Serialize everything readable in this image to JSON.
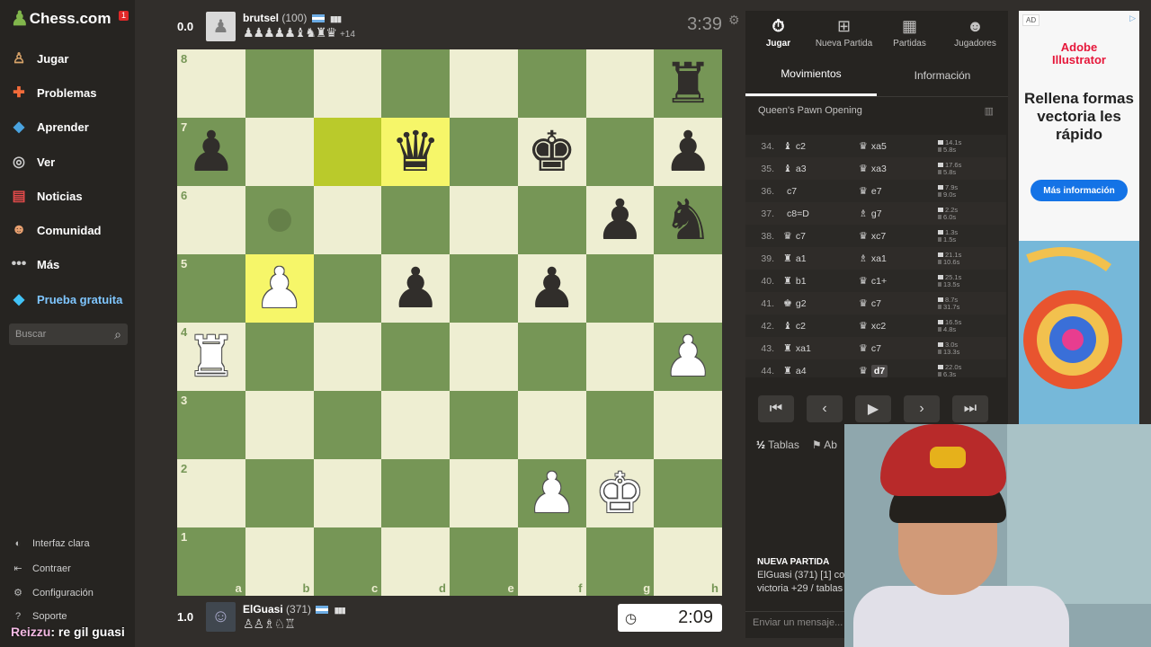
{
  "sidebar": {
    "logo_text": "Chess.com",
    "badge": "1",
    "items": [
      {
        "label": "Jugar",
        "icon": "play-icon"
      },
      {
        "label": "Problemas",
        "icon": "puzzle-icon"
      },
      {
        "label": "Aprender",
        "icon": "learn-icon"
      },
      {
        "label": "Ver",
        "icon": "watch-icon"
      },
      {
        "label": "Noticias",
        "icon": "news-icon"
      },
      {
        "label": "Comunidad",
        "icon": "community-icon"
      },
      {
        "label": "Más",
        "icon": "more-icon"
      },
      {
        "label": "Prueba gratuita",
        "icon": "diamond-icon"
      }
    ],
    "search_placeholder": "Buscar",
    "bottom": [
      {
        "label": "Interfaz clara",
        "icon": "theme-icon"
      },
      {
        "label": "Contraer",
        "icon": "collapse-icon"
      },
      {
        "label": "Configuración",
        "icon": "settings-icon"
      },
      {
        "label": "Soporte",
        "icon": "support-icon"
      }
    ]
  },
  "chat_overlay": {
    "user": "Reizzu",
    "message": ": re gil guasi"
  },
  "top_player": {
    "score": "0.0",
    "name": "brutsel",
    "rating": "(100)",
    "captured": "♟♟♟♟♟♝♞♜♛",
    "advantage": "+14",
    "clock": "3:39"
  },
  "bottom_player": {
    "score": "1.0",
    "name": "ElGuasi",
    "rating": "(371)",
    "captured": "♙♙♗♘♖",
    "clock": "2:09"
  },
  "board": {
    "files": [
      "a",
      "b",
      "c",
      "d",
      "e",
      "f",
      "g",
      "h"
    ],
    "ranks": [
      "8",
      "7",
      "6",
      "5",
      "4",
      "3",
      "2",
      "1"
    ],
    "highlights": [
      "c7",
      "d7",
      "b5"
    ],
    "move_hint": "b6",
    "pieces": {
      "h8": {
        "glyph": "♜",
        "color": "black"
      },
      "a7": {
        "glyph": "♟",
        "color": "black"
      },
      "d7": {
        "glyph": "♛",
        "color": "black"
      },
      "f7": {
        "glyph": "♚",
        "color": "black"
      },
      "h7": {
        "glyph": "♟",
        "color": "black"
      },
      "g6": {
        "glyph": "♟",
        "color": "black"
      },
      "h6": {
        "glyph": "♞",
        "color": "black"
      },
      "b5": {
        "glyph": "♟",
        "color": "white"
      },
      "d5": {
        "glyph": "♟",
        "color": "black"
      },
      "f5": {
        "glyph": "♟",
        "color": "black"
      },
      "a4": {
        "glyph": "♜",
        "color": "white"
      },
      "h4": {
        "glyph": "♟",
        "color": "white"
      },
      "f2": {
        "glyph": "♟",
        "color": "white"
      },
      "g2": {
        "glyph": "♚",
        "color": "white"
      }
    }
  },
  "panel": {
    "tabs": [
      {
        "label": "Jugar",
        "icon": "timer-icon"
      },
      {
        "label": "Nueva Partida",
        "icon": "plus-icon"
      },
      {
        "label": "Partidas",
        "icon": "games-icon"
      },
      {
        "label": "Jugadores",
        "icon": "players-icon"
      }
    ],
    "subtabs": [
      "Movimientos",
      "Información"
    ],
    "opening": "Queen's Pawn Opening",
    "moves": [
      {
        "n": "34.",
        "wi": "♝",
        "w": "c2",
        "bi": "♛",
        "b": "xa5",
        "tw": "14.1s",
        "tb": "5.8s"
      },
      {
        "n": "35.",
        "wi": "♝",
        "w": "a3",
        "bi": "♛",
        "b": "xa3",
        "tw": "17.6s",
        "tb": "5.8s"
      },
      {
        "n": "36.",
        "wi": "",
        "w": "c7",
        "bi": "♛",
        "b": "e7",
        "tw": "7.9s",
        "tb": "9.0s"
      },
      {
        "n": "37.",
        "wi": "",
        "w": "c8=D",
        "bi": "♗",
        "b": "g7",
        "tw": "2.2s",
        "tb": "6.0s"
      },
      {
        "n": "38.",
        "wi": "♛",
        "w": "c7",
        "bi": "♛",
        "b": "xc7",
        "tw": "1.3s",
        "tb": "1.5s"
      },
      {
        "n": "39.",
        "wi": "♜",
        "w": "a1",
        "bi": "♗",
        "b": "xa1",
        "tw": "21.1s",
        "tb": "10.6s"
      },
      {
        "n": "40.",
        "wi": "♜",
        "w": "b1",
        "bi": "♛",
        "b": "c1+",
        "tw": "25.1s",
        "tb": "13.5s"
      },
      {
        "n": "41.",
        "wi": "♚",
        "w": "g2",
        "bi": "♛",
        "b": "c7",
        "tw": "8.7s",
        "tb": "31.7s"
      },
      {
        "n": "42.",
        "wi": "♝",
        "w": "c2",
        "bi": "♛",
        "b": "xc2",
        "tw": "16.5s",
        "tb": "4.8s"
      },
      {
        "n": "43.",
        "wi": "♜",
        "w": "xa1",
        "bi": "♛",
        "b": "c7",
        "tw": "3.0s",
        "tb": "13.3s"
      },
      {
        "n": "44.",
        "wi": "♜",
        "w": "a4",
        "bi": "♛",
        "b": "d7",
        "tw": "22.0s",
        "tb": "6.3s"
      }
    ],
    "actions": {
      "draw": "Tablas",
      "abort": "Ab"
    },
    "new_game_title": "NUEVA PARTIDA",
    "new_game_line1": "ElGuasi (371) [1] co",
    "new_game_line2": "victoria +29 / tablas",
    "chat_placeholder": "Enviar un mensaje..."
  },
  "ad": {
    "badge": "AD",
    "brand_line1": "Adobe",
    "brand_line2": "Illustrator",
    "headline": "Rellena formas vectoria les rápido",
    "button": "Más información"
  }
}
